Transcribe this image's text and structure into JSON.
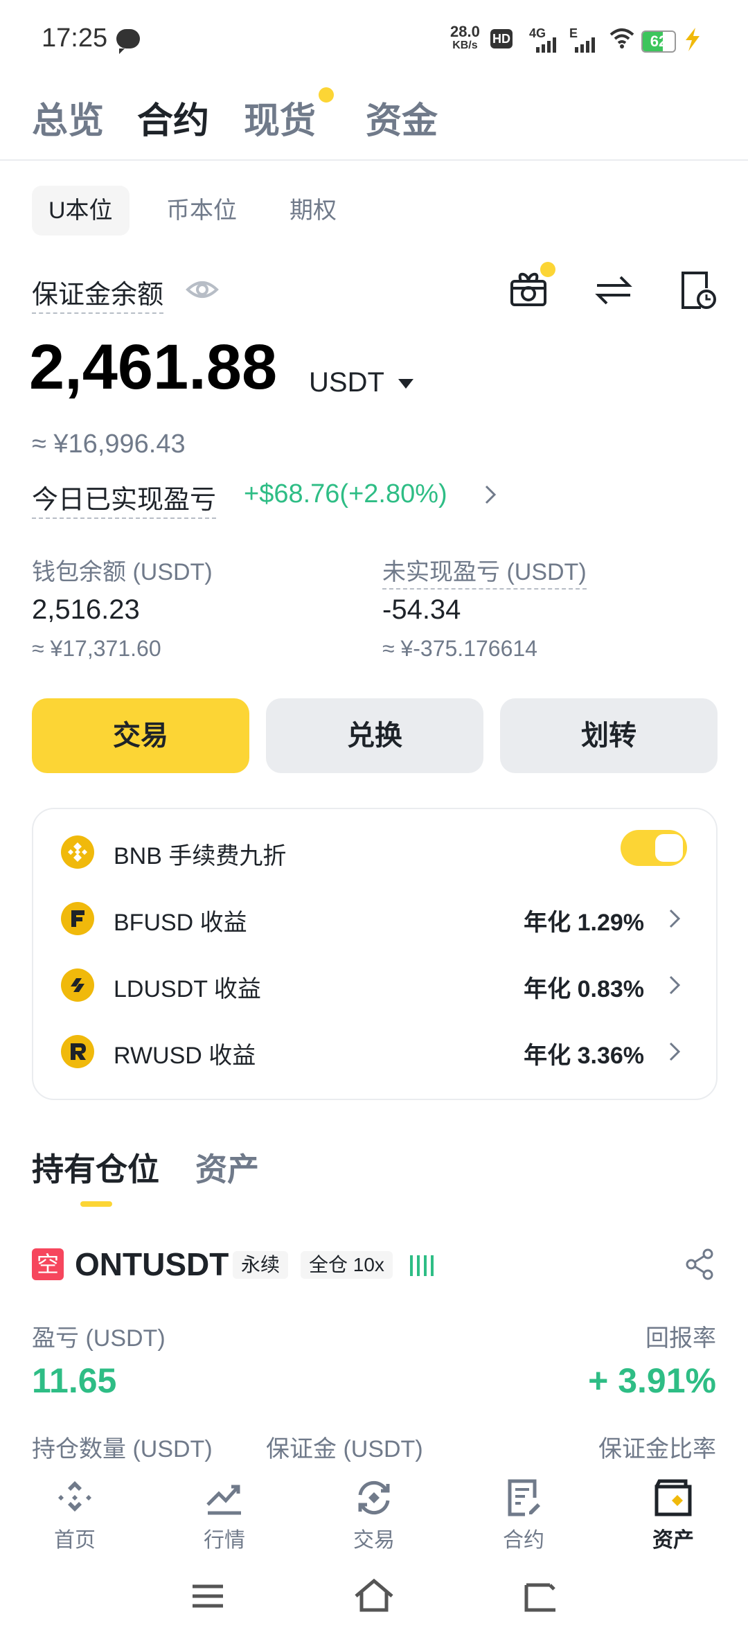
{
  "status_bar": {
    "time": "17:25",
    "speed_value": "28.0",
    "speed_unit": "KB/s",
    "hd_label": "HD",
    "net1": "4G",
    "net2": "E",
    "battery": "62",
    "battery_level": 0.62,
    "battery_color": "#3cc55c"
  },
  "top_tabs": [
    {
      "label": "总览"
    },
    {
      "label": "合约"
    },
    {
      "label": "现货"
    },
    {
      "label": "资金"
    }
  ],
  "sub_tabs": [
    {
      "label": "U本位"
    },
    {
      "label": "币本位"
    },
    {
      "label": "期权"
    }
  ],
  "balance": {
    "label": "保证金余额",
    "amount": "2,461.88",
    "currency": "USDT",
    "approx": "≈ ¥16,996.43",
    "pnl_label": "今日已实现盈亏",
    "pnl_value": "+$68.76(+2.80%)"
  },
  "wallet": {
    "label": "钱包余额 (USDT)",
    "value": "2,516.23",
    "approx": "≈ ¥17,371.60"
  },
  "unrealized": {
    "label": "未实现盈亏 (USDT)",
    "value": "-54.34",
    "approx": "≈ ¥-375.176614"
  },
  "actions": {
    "trade": "交易",
    "convert": "兑换",
    "transfer": "划转"
  },
  "card_rows": [
    {
      "label": "BNB 手续费九折",
      "right": ""
    },
    {
      "label": "BFUSD 收益",
      "right": "年化 1.29%"
    },
    {
      "label": "LDUSDT 收益",
      "right": "年化 0.83%"
    },
    {
      "label": "RWUSD 收益",
      "right": "年化 3.36%"
    }
  ],
  "section_tabs": [
    {
      "label": "持有仓位"
    },
    {
      "label": "资产"
    }
  ],
  "position": {
    "side": "空",
    "symbol": "ONTUSDT",
    "tag_perp": "永续",
    "tag_margin": "全仓 10x",
    "pnl_label": "盈亏 (USDT)",
    "pnl_value": "11.65",
    "roe_label": "回报率",
    "roe_value": "+ 3.91%",
    "size_label": "持仓数量 (USDT)",
    "margin_label": "保证金 (USDT)",
    "ratio_label": "保证金比率"
  },
  "bottom_nav": [
    {
      "label": "首页"
    },
    {
      "label": "行情"
    },
    {
      "label": "交易"
    },
    {
      "label": "合约"
    },
    {
      "label": "资产"
    }
  ],
  "colors": {
    "accent": "#fcd535",
    "up": "#2ebd85",
    "short": "#f6465d"
  }
}
